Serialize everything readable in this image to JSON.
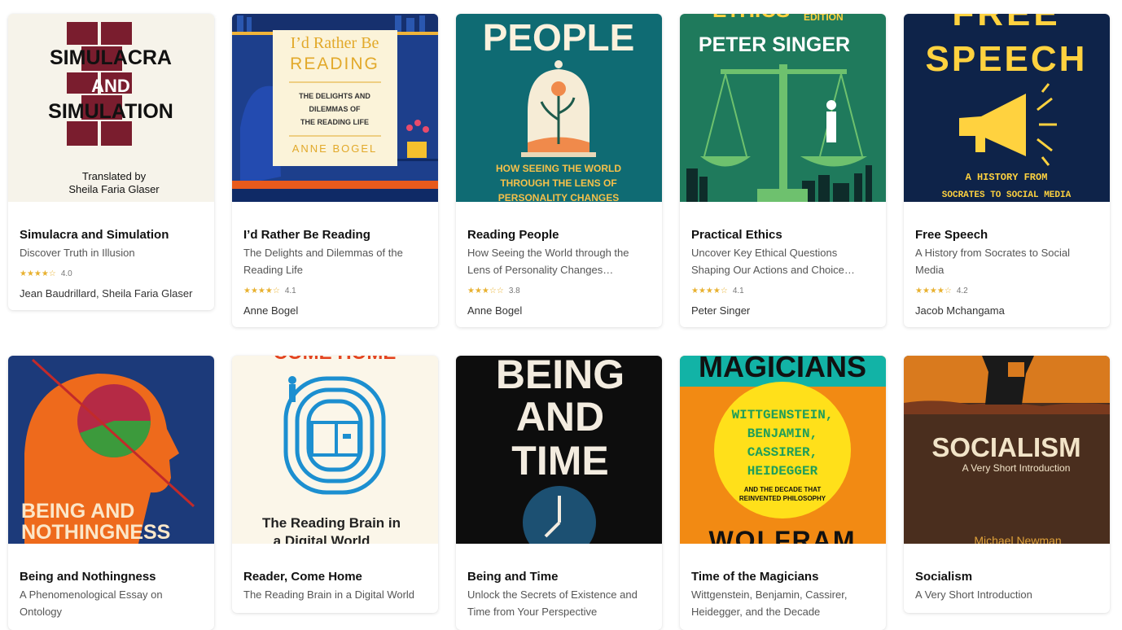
{
  "books": [
    {
      "title": "Simulacra and Simulation",
      "subtitle": "Discover Truth in Illusion",
      "stars": "★★★★☆",
      "rating": "4.0",
      "author": "Jean Baudrillard, Sheila Faria Glaser",
      "cover": {
        "line1": "SIMULACRA",
        "line2": "AND",
        "line3": "SIMULATION",
        "credit1": "Translated by",
        "credit2": "Sheila Faria Glaser"
      }
    },
    {
      "title": "I’d Rather Be Reading",
      "subtitle": "The Delights and Dilemmas of the Reading Life",
      "stars": "★★★★☆",
      "rating": "4.1",
      "author": "Anne Bogel",
      "cover": {
        "line1": "I’d Rather Be",
        "line2": "READING",
        "sub1": "THE DELIGHTS AND",
        "sub2": "DILEMMAS OF",
        "sub3": "THE READING LIFE",
        "author": "ANNE BOGEL"
      }
    },
    {
      "title": "Reading People",
      "subtitle": "How Seeing the World through the Lens of Personality Changes…",
      "stars": "★★★☆☆",
      "rating": "3.8",
      "author": "Anne Bogel",
      "cover": {
        "line1": "PEOPLE",
        "sub1": "HOW SEEING THE WORLD",
        "sub2": "THROUGH THE LENS OF",
        "sub3": "PERSONALITY CHANGES"
      }
    },
    {
      "title": "Practical Ethics",
      "subtitle": "Uncover Key Ethical Questions Shaping Our Actions and Choice…",
      "stars": "★★★★☆",
      "rating": "4.1",
      "author": "Peter Singer",
      "cover": {
        "top": "ETHICS",
        "edition": "EDITION",
        "author": "PETER SINGER"
      }
    },
    {
      "title": "Free Speech",
      "subtitle": "A History from Socrates to Social Media",
      "stars": "★★★★☆",
      "rating": "4.2",
      "author": "Jacob Mchangama",
      "cover": {
        "top": "FREE",
        "line1": "SPEECH",
        "sub1": "A HISTORY FROM",
        "sub2": "SOCRATES TO SOCIAL MEDIA"
      }
    },
    {
      "title": "Being and Nothingness",
      "subtitle": "A Phenomenological Essay on Ontology",
      "author": "",
      "cover": {
        "line1": "BEING AND",
        "line2": "NOTHINGNESS"
      }
    },
    {
      "title": "Reader, Come Home",
      "subtitle": "The Reading Brain in a Digital World",
      "author": "",
      "cover": {
        "top": "COME HOME",
        "line1": "The Reading Brain in",
        "line2": "a Digital World"
      }
    },
    {
      "title": "Being and Time",
      "subtitle": "Unlock the Secrets of Existence and Time from Your Perspective",
      "author": "",
      "cover": {
        "line1": "BEING",
        "line2": "AND",
        "line3": "TIME"
      }
    },
    {
      "title": "Time of the Magicians",
      "subtitle": "Wittgenstein, Benjamin, Cassirer, Heidegger, and the Decade",
      "author": "",
      "cover": {
        "top": "MAGICIANS",
        "l1": "WITTGENSTEIN,",
        "l2": "BENJAMIN,",
        "l3": "CASSIRER,",
        "l4": "HEIDEGGER",
        "s1": "AND THE DECADE THAT",
        "s2": "REINVENTED PHILOSOPHY",
        "author": "WOLFRAM"
      }
    },
    {
      "title": "Socialism",
      "subtitle": "A Very Short Introduction",
      "author": "",
      "cover": {
        "line1": "SOCIALISM",
        "sub": "A Very Short Introduction",
        "author": "Michael Newman"
      }
    }
  ]
}
